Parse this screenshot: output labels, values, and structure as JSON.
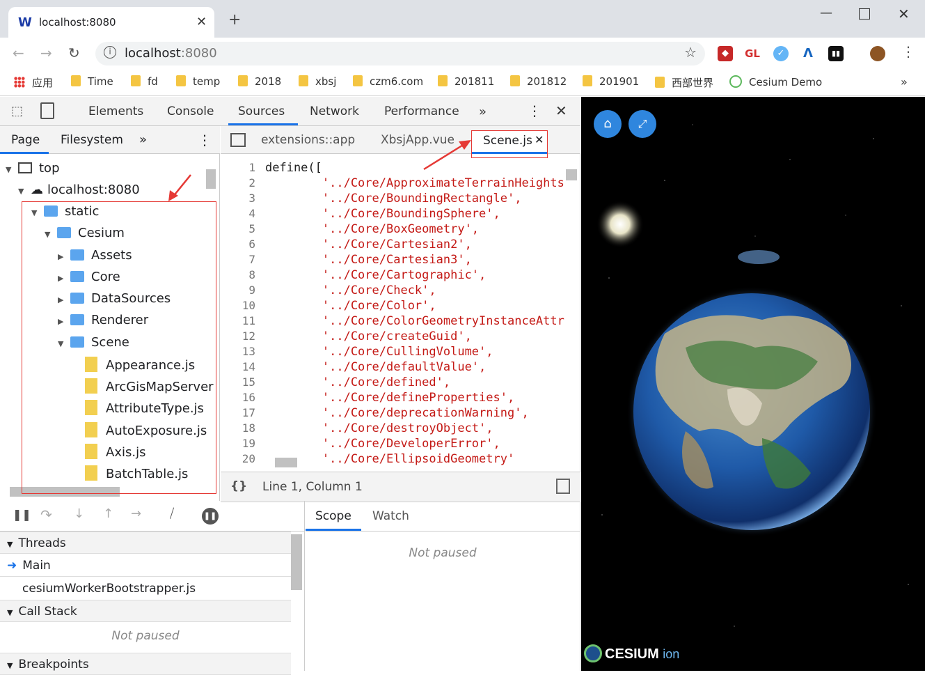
{
  "browser": {
    "tab_title": "localhost:8080",
    "url_host": "localhost",
    "url_port": ":8080",
    "tab_favicon": "W"
  },
  "extensions": [
    "GL"
  ],
  "bookmarks": {
    "apps_label": "应用",
    "items": [
      "Time",
      "fd",
      "temp",
      "2018",
      "xbsj",
      "czm6.com",
      "201811",
      "201812",
      "201901",
      "西部世界",
      "Cesium Demo"
    ]
  },
  "devtools": {
    "tabs": [
      "Elements",
      "Console",
      "Sources",
      "Network",
      "Performance"
    ],
    "active_tab": "Sources",
    "navigator": {
      "tabs": [
        "Page",
        "Filesystem"
      ],
      "tree": [
        {
          "label": "top",
          "depth": 0,
          "icon": "frame-icon",
          "expanded": true
        },
        {
          "label": "localhost:8080",
          "depth": 1,
          "icon": "cloud-icon",
          "expanded": true
        },
        {
          "label": "static",
          "depth": 2,
          "icon": "folder-icon",
          "expanded": true
        },
        {
          "label": "Cesium",
          "depth": 3,
          "icon": "folder-icon",
          "expanded": true
        },
        {
          "label": "Assets",
          "depth": 4,
          "icon": "folder-icon",
          "expanded": false
        },
        {
          "label": "Core",
          "depth": 4,
          "icon": "folder-icon",
          "expanded": false
        },
        {
          "label": "DataSources",
          "depth": 4,
          "icon": "folder-icon",
          "expanded": false
        },
        {
          "label": "Renderer",
          "depth": 4,
          "icon": "folder-icon",
          "expanded": false
        },
        {
          "label": "Scene",
          "depth": 4,
          "icon": "folder-icon",
          "expanded": true
        },
        {
          "label": "Appearance.js",
          "depth": 5,
          "icon": "file-icon"
        },
        {
          "label": "ArcGisMapServer",
          "depth": 5,
          "icon": "file-icon"
        },
        {
          "label": "AttributeType.js",
          "depth": 5,
          "icon": "file-icon"
        },
        {
          "label": "AutoExposure.js",
          "depth": 5,
          "icon": "file-icon"
        },
        {
          "label": "Axis.js",
          "depth": 5,
          "icon": "file-icon"
        },
        {
          "label": "BatchTable.js",
          "depth": 5,
          "icon": "file-icon"
        }
      ]
    },
    "editor": {
      "tabs": [
        "extensions::app",
        "XbsjApp.vue",
        "Scene.js"
      ],
      "active_tab": "Scene.js",
      "lines": [
        "define([",
        "        '../Core/ApproximateTerrainHeights",
        "        '../Core/BoundingRectangle',",
        "        '../Core/BoundingSphere',",
        "        '../Core/BoxGeometry',",
        "        '../Core/Cartesian2',",
        "        '../Core/Cartesian3',",
        "        '../Core/Cartographic',",
        "        '../Core/Check',",
        "        '../Core/Color',",
        "        '../Core/ColorGeometryInstanceAttr",
        "        '../Core/createGuid',",
        "        '../Core/CullingVolume',",
        "        '../Core/defaultValue',",
        "        '../Core/defined',",
        "        '../Core/defineProperties',",
        "        '../Core/deprecationWarning',",
        "        '../Core/destroyObject',",
        "        '../Core/DeveloperError',",
        "        '../Core/EllipsoidGeometry'"
      ],
      "status": "Line 1, Column 1",
      "format_label": "{}"
    },
    "debugger": {
      "threads_label": "Threads",
      "threads": [
        "Main",
        "cesiumWorkerBootstrapper.js"
      ],
      "callstack_label": "Call Stack",
      "callstack_status": "Not paused",
      "breakpoints_label": "Breakpoints",
      "right_tabs": [
        "Scope",
        "Watch"
      ],
      "scope_status": "Not paused"
    }
  },
  "viewer": {
    "logo_text": "CESIUM",
    "logo_suffix": "ion"
  }
}
